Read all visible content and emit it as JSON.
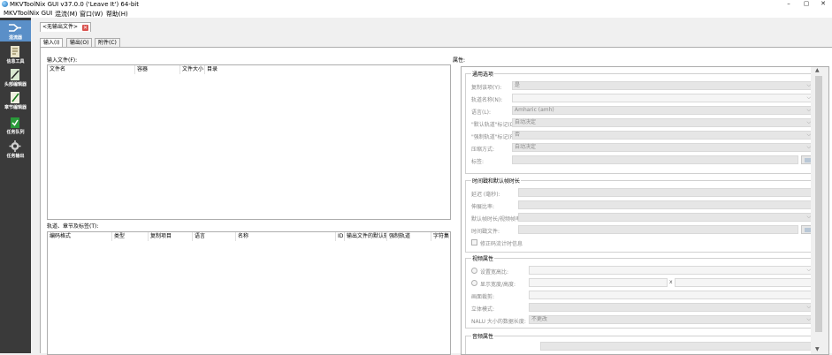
{
  "window": {
    "title": "MKVToolNix GUI v37.0.0 ('Leave It') 64-bit",
    "minimize": "–",
    "maximize": "▢",
    "close": "✕"
  },
  "menu": [
    "MKVToolNix GUI",
    "混流(M)",
    "窗口(W)",
    "帮助(H)"
  ],
  "sidebar": [
    {
      "label": "混流器",
      "icon": "merge-icon"
    },
    {
      "label": "信息工具",
      "icon": "info-tool-icon"
    },
    {
      "label": "头部编辑器",
      "icon": "header-editor-icon"
    },
    {
      "label": "章节编辑器",
      "icon": "chapter-editor-icon"
    },
    {
      "label": "任务队列",
      "icon": "job-queue-icon"
    },
    {
      "label": "任务输出",
      "icon": "job-output-icon"
    }
  ],
  "doc_tab": {
    "label": "<无输出文件>",
    "close": "✕"
  },
  "sub_tabs": [
    "输入(I)",
    "输出(O)",
    "附件(C)"
  ],
  "input_files": {
    "label": "输入文件(F):",
    "columns": [
      "文件名",
      "容器",
      "文件大小",
      "目录"
    ]
  },
  "tracks": {
    "label": "轨道、章节及标签(T):",
    "columns": [
      "编码格式",
      "类型",
      "复制项目",
      "语言",
      "名称",
      "ID",
      "输出文件的默认轨",
      "强制轨道",
      "字符集"
    ]
  },
  "properties": {
    "label": "属性:",
    "general": {
      "title": "通用选项",
      "rows": [
        {
          "label": "复制该项(Y):",
          "value": "是"
        },
        {
          "label": "轨道名称(N):",
          "value": ""
        },
        {
          "label": "语言(L):",
          "value": "Amharic (amh)"
        },
        {
          "label": "\"默认轨道\"标记(D):",
          "value": "自动决定"
        },
        {
          "label": "\"强制轨道\"标记(F):",
          "value": "否"
        },
        {
          "label": "压缩方式:",
          "value": "自动决定"
        },
        {
          "label": "标签:",
          "value": ""
        }
      ]
    },
    "timing": {
      "title": "时间戳和默认帧时长",
      "rows": [
        {
          "label": "延迟 (毫秒):",
          "value": ""
        },
        {
          "label": "伸展比率:",
          "value": ""
        },
        {
          "label": "默认帧时长/视频帧率:",
          "value": ""
        },
        {
          "label": "时间戳文件:",
          "value": ""
        }
      ],
      "fix_bitstream": "修正码流计时信息"
    },
    "video": {
      "title": "视频属性",
      "aspect_ratio": "设置宽高比:",
      "display_size": "显示宽度/高度:",
      "size_sep": "x",
      "crop": "画面裁剪:",
      "stereo": "立体模式:",
      "nalu": "NALU 大小的数据长度:",
      "nalu_value": "不更改"
    },
    "audio": {
      "title": "音频属性"
    }
  }
}
